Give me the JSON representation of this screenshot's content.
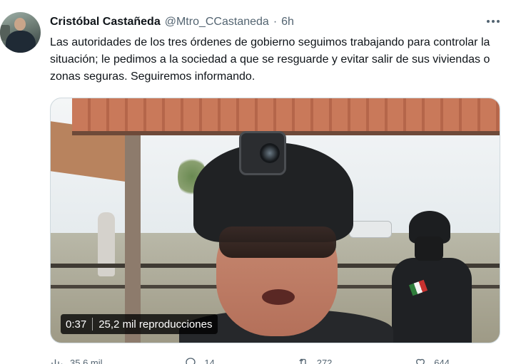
{
  "tweet": {
    "author_name": "Cristóbal Castañeda",
    "author_handle": "@Mtro_CCastaneda",
    "separator": "·",
    "time": "6h",
    "text": "Las autoridades de los tres órdenes de gobierno seguimos trabajando para controlar la situación; le pedimos a la sociedad a que se resguarde y evitar salir de sus viviendas o zonas seguras. Seguiremos informando."
  },
  "video": {
    "timecode": "0:37",
    "views": "25,2 mil reproducciones"
  },
  "actions": {
    "reply_count": "14",
    "retweet_count": "272",
    "like_count": "644",
    "view_count": "35,6 mil"
  },
  "icons": {
    "more": "more-dots-icon",
    "views": "analytics-icon",
    "reply": "reply-icon",
    "retweet": "retweet-icon",
    "like": "heart-icon"
  },
  "colors": {
    "text": "#0f1419",
    "secondary": "#536471",
    "border": "#cfd9de"
  }
}
